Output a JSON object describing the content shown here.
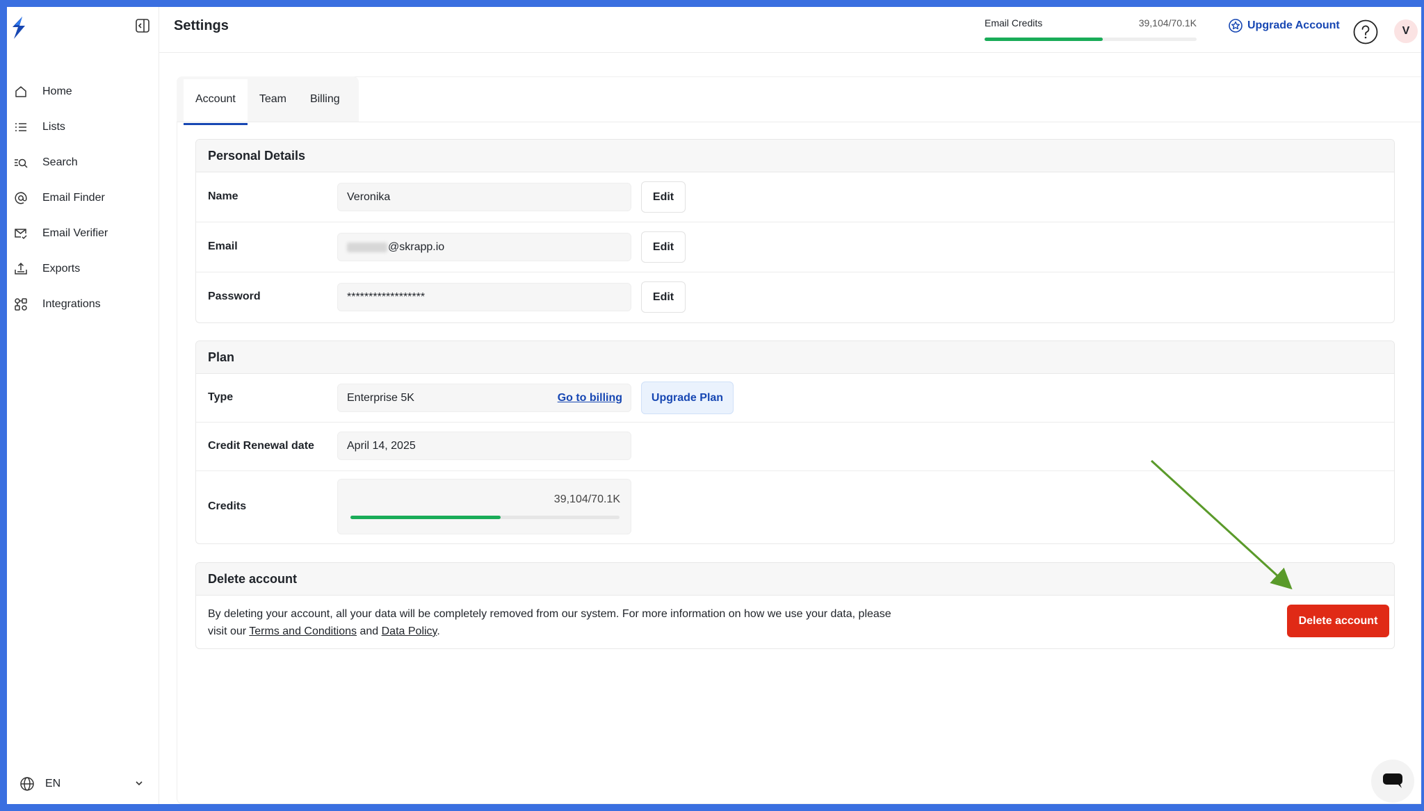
{
  "sidebar": {
    "items": [
      {
        "label": "Home",
        "icon": "home-icon"
      },
      {
        "label": "Lists",
        "icon": "list-icon"
      },
      {
        "label": "Search",
        "icon": "search-list-icon"
      },
      {
        "label": "Email Finder",
        "icon": "at-icon"
      },
      {
        "label": "Email Verifier",
        "icon": "mail-check-icon"
      },
      {
        "label": "Exports",
        "icon": "export-icon"
      },
      {
        "label": "Integrations",
        "icon": "integrations-icon"
      }
    ],
    "language": "EN"
  },
  "header": {
    "title": "Settings",
    "credits_label": "Email Credits",
    "credits_value": "39,104/70.1K",
    "credits_fraction": 0.558,
    "upgrade_label": "Upgrade Account",
    "avatar_initial": "V"
  },
  "tabs": [
    {
      "label": "Account",
      "active": true
    },
    {
      "label": "Team",
      "active": false
    },
    {
      "label": "Billing",
      "active": false
    }
  ],
  "personal": {
    "title": "Personal Details",
    "name_label": "Name",
    "name_value": "Veronika",
    "email_label": "Email",
    "email_value": "@skrapp.io",
    "password_label": "Password",
    "password_value": "******************",
    "edit_label": "Edit"
  },
  "plan": {
    "title": "Plan",
    "type_label": "Type",
    "type_value": "Enterprise 5K",
    "billing_link": "Go to billing",
    "upgrade_plan": "Upgrade Plan",
    "renewal_label": "Credit Renewal date",
    "renewal_value": "April 14, 2025",
    "credits_label": "Credits",
    "credits_value": "39,104/70.1K",
    "credits_fraction": 0.558
  },
  "delete": {
    "title": "Delete account",
    "text_before": "By deleting your account, all your data will be completely removed from our system. For more information on how we use your data, please visit our ",
    "terms_link": "Terms and Conditions",
    "and": " and ",
    "policy_link": "Data Policy",
    "text_after": ".",
    "button": "Delete account"
  },
  "colors": {
    "brand": "#1747b3",
    "progress": "#1aac58",
    "danger": "#e02a16",
    "annotation_arrow": "#5a9a2a",
    "frame": "#3a6fe0"
  }
}
